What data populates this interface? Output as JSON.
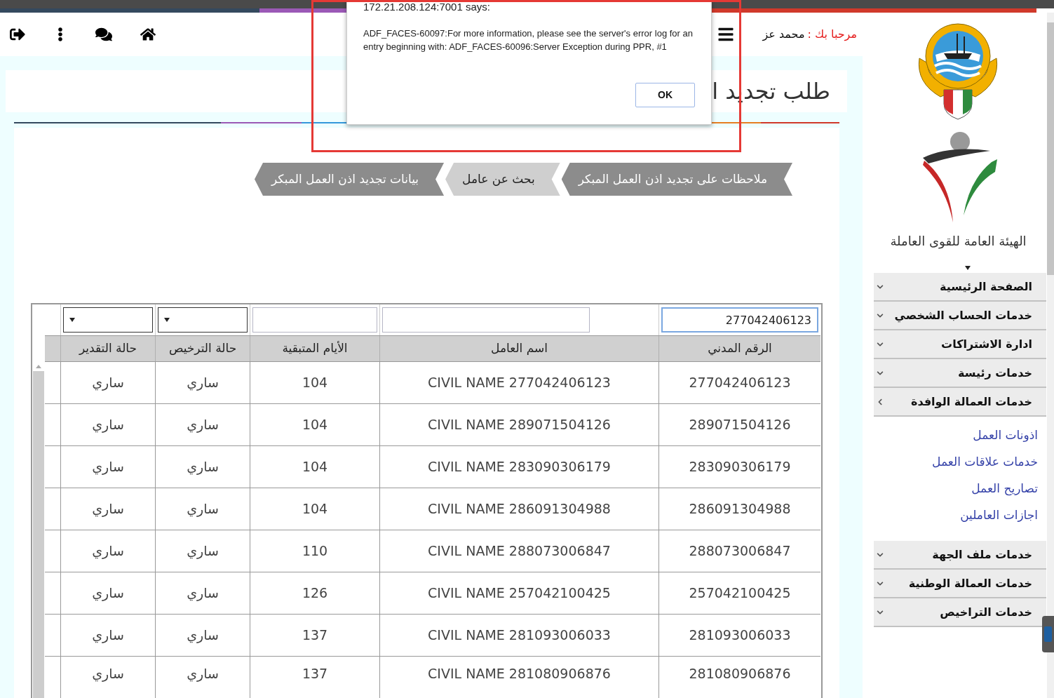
{
  "header": {
    "greeting": "مرحبا بك :",
    "user": "محمد عز"
  },
  "page_title": "طلب تجديد ا",
  "tabs": [
    {
      "label": "ملاحظات على تجديد اذن العمل المبكر",
      "selected": false
    },
    {
      "label": "بحث عن عامل",
      "selected": true
    },
    {
      "label": "بيانات تجديد اذن العمل المبكر",
      "selected": false
    }
  ],
  "table": {
    "filters": [
      {
        "kind": "text",
        "value": "277042406123",
        "focused": true
      },
      {
        "kind": "text",
        "focused": false
      },
      {
        "kind": "text",
        "focused": false
      },
      {
        "kind": "select",
        "focused": false
      },
      {
        "kind": "select",
        "focused": false
      }
    ],
    "columns": [
      "الرقم المدني",
      "اسم العامل",
      "الأيام المتبقية",
      "حالة الترخيص",
      "حالة التقدير"
    ],
    "rows": [
      [
        "277042406123",
        "CIVIL NAME 277042406123",
        "104",
        "ساري",
        "ساري"
      ],
      [
        "289071504126",
        "CIVIL NAME 289071504126",
        "104",
        "ساري",
        "ساري"
      ],
      [
        "283090306179",
        "CIVIL NAME 283090306179",
        "104",
        "ساري",
        "ساري"
      ],
      [
        "286091304988",
        "CIVIL NAME 286091304988",
        "104",
        "ساري",
        "ساري"
      ],
      [
        "288073006847",
        "CIVIL NAME 288073006847",
        "110",
        "ساري",
        "ساري"
      ],
      [
        "257042100425",
        "CIVIL NAME 257042100425",
        "126",
        "ساري",
        "ساري"
      ],
      [
        "281093006033",
        "CIVIL NAME 281093006033",
        "137",
        "ساري",
        "ساري"
      ],
      [
        "281080906876",
        "CIVIL NAME 281080906876",
        "137",
        "ساري",
        "ساري"
      ]
    ]
  },
  "sidebar": {
    "org_name": "الهيئة العامة للقوى العاملة",
    "menu": [
      {
        "label": "الصفحة الرئيسية",
        "expanded": false
      },
      {
        "label": "خدمات الحساب الشخصي",
        "expanded": false
      },
      {
        "label": "ادارة الاشتراكات",
        "expanded": false
      },
      {
        "label": "خدمات رئيسة",
        "expanded": false
      },
      {
        "label": "خدمات العمالة الوافدة",
        "expanded": true,
        "children": [
          {
            "label": "اذونات العمل"
          },
          {
            "label": "خدمات علاقات العمل"
          },
          {
            "label": "تصاريح العمل"
          },
          {
            "label": "اجازات العاملين"
          }
        ]
      },
      {
        "label": "خدمات ملف الجهة",
        "expanded": false
      },
      {
        "label": "خدمات العمالة الوطنية",
        "expanded": false
      },
      {
        "label": "خدمات التراخيص",
        "expanded": false
      }
    ]
  },
  "dialog": {
    "title": "172.21.208.124:7001 says:",
    "message": "ADF_FACES-60097:For more information, please see the server's error log for an entry beginning with: ADF_FACES-60096:Server Exception during PPR, #1",
    "button": "OK"
  }
}
